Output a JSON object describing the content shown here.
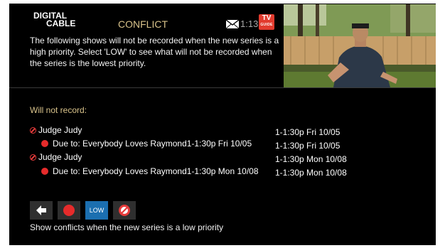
{
  "header": {
    "brand_line1": "DIGITAL",
    "brand_line2": "CABLE",
    "title": "CONFLICT",
    "time": "1:13pm",
    "tvguide_line1": "TV",
    "tvguide_line2": "GUIDE"
  },
  "description": "The following shows will not be recorded when the new series is a high priority. Select 'LOW' to see what will not be recorded when the series is the lowest priority.",
  "section_label": "Will not record:",
  "conflicts": [
    {
      "show": "Judge Judy",
      "due_to": "Due to: Everybody Loves Raymond1-1:30p  Fri 10/05",
      "time1": "1-1:30p  Fri 10/05",
      "time2": "1-1:30p  Fri 10/05"
    },
    {
      "show": "Judge Judy",
      "due_to": "Due to: Everybody Loves Raymond1-1:30p  Mon 10/08",
      "time1": "1-1:30p  Mon 10/08",
      "time2": "1-1:30p  Mon 10/08"
    }
  ],
  "buttons": {
    "back": "back-arrow-icon",
    "record": "record-icon",
    "low_label": "LOW",
    "cancel": "prohibited-icon"
  },
  "hint": "Show conflicts when the new series is a low priority",
  "colors": {
    "accent_gold": "#d8c28a",
    "record_red": "#e62b2b",
    "selected_blue": "#1b6fb0",
    "tvguide_red": "#e23b2e"
  }
}
